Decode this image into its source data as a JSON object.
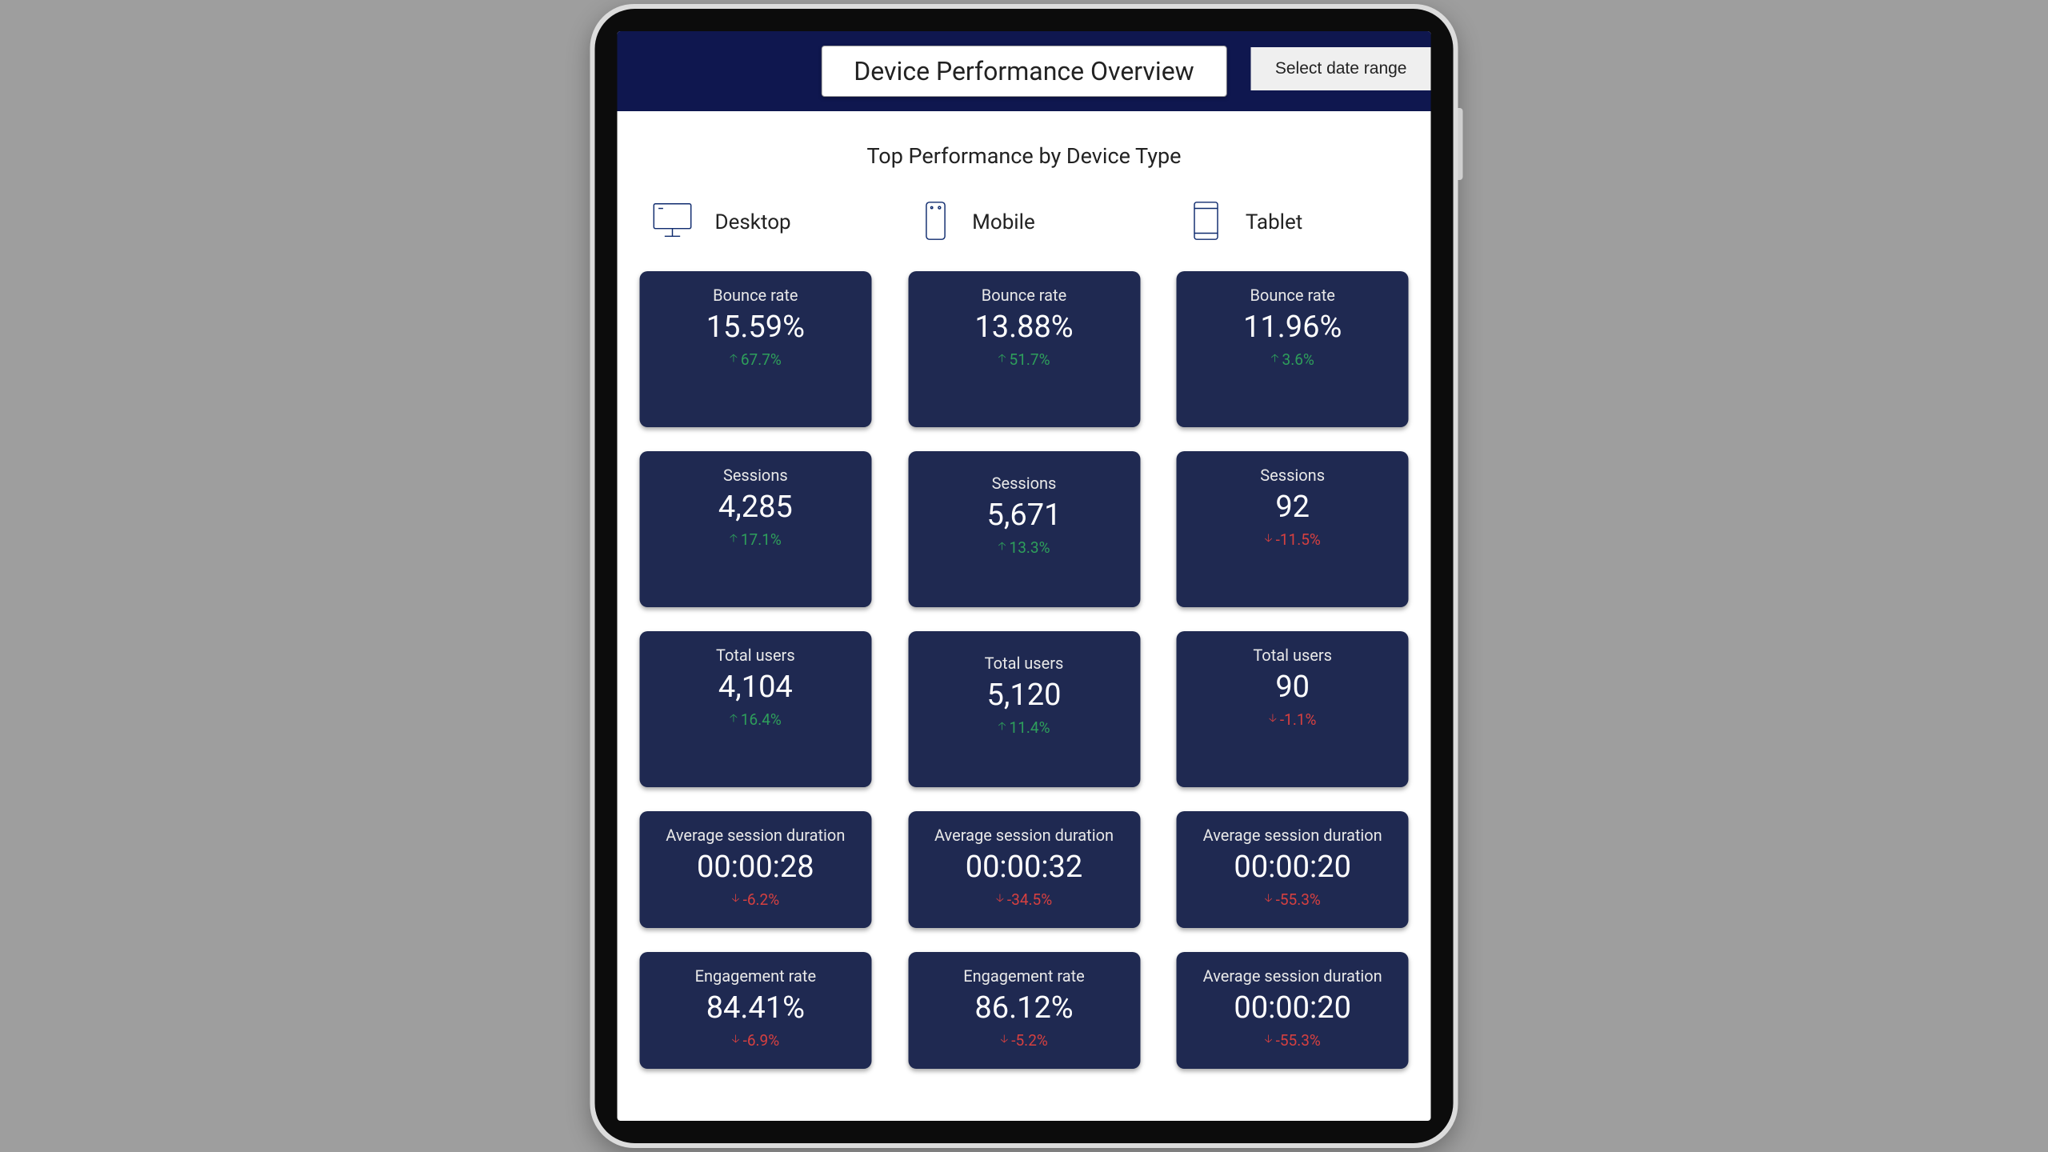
{
  "header": {
    "title": "Device Performance Overview",
    "date_button": "Select date range"
  },
  "section_title": "Top Performance by Device Type",
  "columns": [
    {
      "label": "Desktop",
      "icon": "desktop-icon",
      "cards": [
        {
          "label": "Bounce rate",
          "value": "15.59%",
          "delta": "67.7%",
          "dir": "up"
        },
        {
          "label": "Sessions",
          "value": "4,285",
          "delta": "17.1%",
          "dir": "up"
        },
        {
          "label": "Total users",
          "value": "4,104",
          "delta": "16.4%",
          "dir": "up"
        },
        {
          "label": "Average session duration",
          "value": "00:00:28",
          "delta": "-6.2%",
          "dir": "down"
        },
        {
          "label": "Engagement rate",
          "value": "84.41%",
          "delta": "-6.9%",
          "dir": "down"
        }
      ]
    },
    {
      "label": "Mobile",
      "icon": "mobile-icon",
      "cards": [
        {
          "label": "Bounce rate",
          "value": "13.88%",
          "delta": "51.7%",
          "dir": "up"
        },
        {
          "label": "Sessions",
          "value": "5,671",
          "delta": "13.3%",
          "dir": "up"
        },
        {
          "label": "Total users",
          "value": "5,120",
          "delta": "11.4%",
          "dir": "up"
        },
        {
          "label": "Average session duration",
          "value": "00:00:32",
          "delta": "-34.5%",
          "dir": "down"
        },
        {
          "label": "Engagement rate",
          "value": "86.12%",
          "delta": "-5.2%",
          "dir": "down"
        }
      ]
    },
    {
      "label": "Tablet",
      "icon": "tablet-icon",
      "cards": [
        {
          "label": "Bounce rate",
          "value": "11.96%",
          "delta": "3.6%",
          "dir": "up"
        },
        {
          "label": "Sessions",
          "value": "92",
          "delta": "-11.5%",
          "dir": "down"
        },
        {
          "label": "Total users",
          "value": "90",
          "delta": "-1.1%",
          "dir": "down"
        },
        {
          "label": "Average session duration",
          "value": "00:00:20",
          "delta": "-55.3%",
          "dir": "down"
        },
        {
          "label": "Average session duration",
          "value": "00:00:20",
          "delta": "-55.3%",
          "dir": "down"
        }
      ]
    }
  ]
}
